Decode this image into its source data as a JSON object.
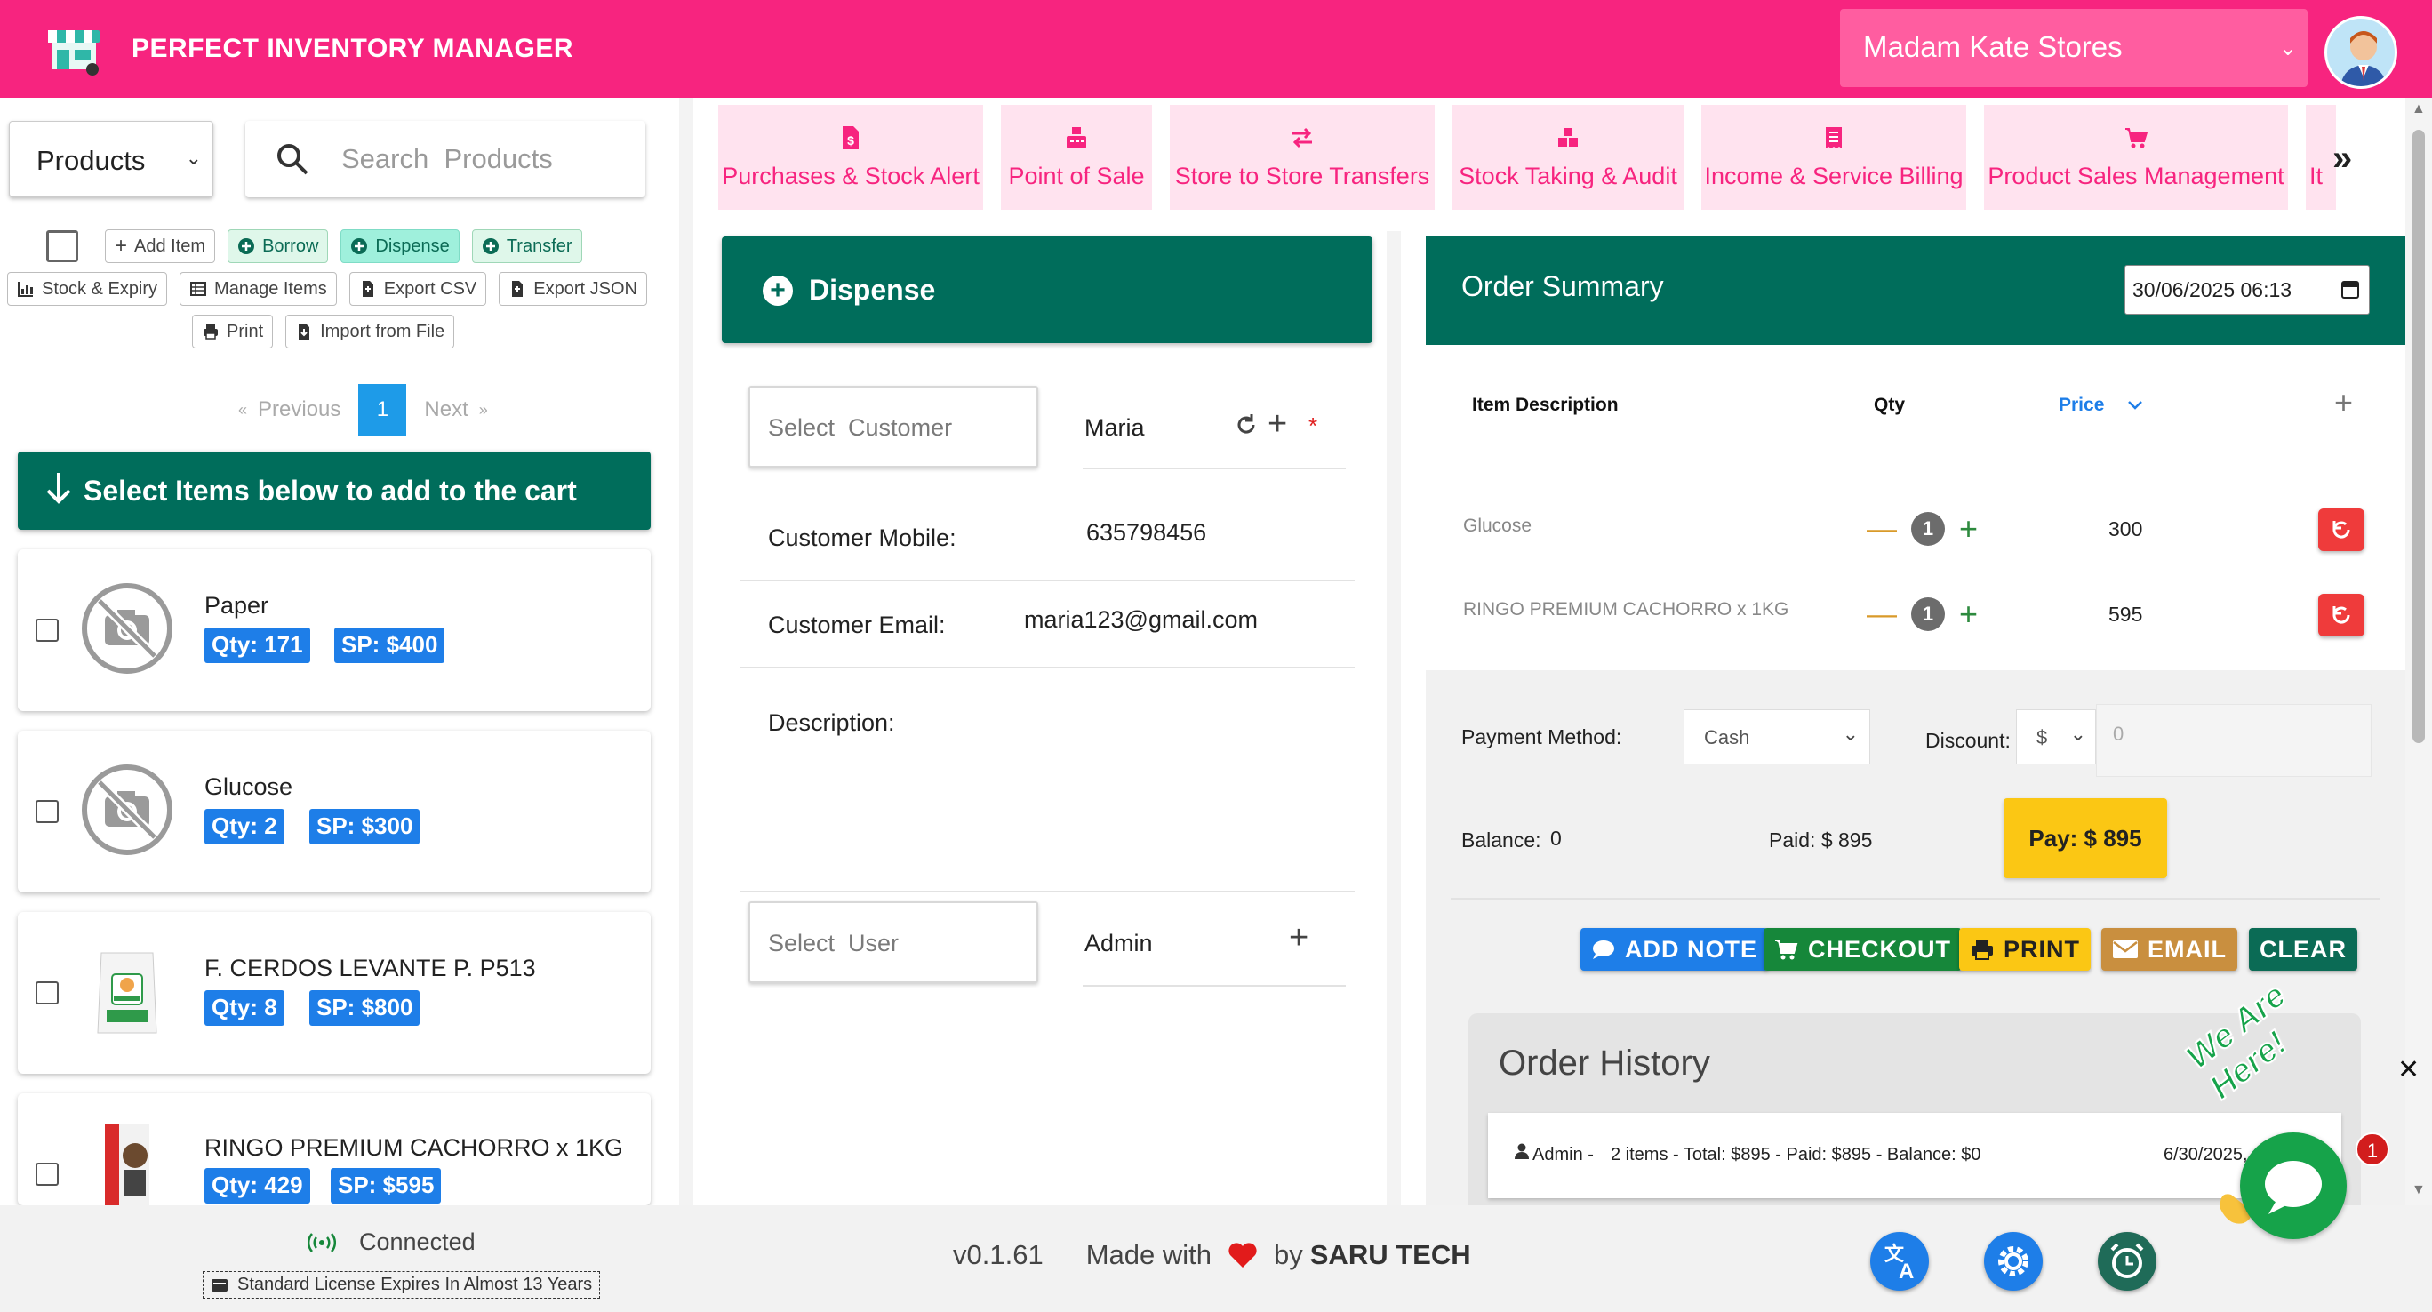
{
  "header": {
    "app_title": "PERFECT INVENTORY MANAGER",
    "store": "Madam Kate Stores",
    "brand_color": "#f7247f"
  },
  "left": {
    "category_select": "Products",
    "search_placeholder": "Search  Products",
    "toolbar_row1": [
      "Add Item",
      "Borrow",
      "Dispense",
      "Transfer"
    ],
    "toolbar_row2": [
      "Stock & Expiry",
      "Manage Items",
      "Export CSV",
      "Export JSON"
    ],
    "toolbar_row3": [
      "Print",
      "Import from File"
    ],
    "pager": {
      "previous": "Previous",
      "current": "1",
      "next": "Next"
    },
    "cart_banner": "Select Items below to add to the cart",
    "products": [
      {
        "name": "Paper",
        "qty": "Qty: 171",
        "sp": "SP: $400"
      },
      {
        "name": "Glucose",
        "qty": "Qty: 2",
        "sp": "SP: $300"
      },
      {
        "name": "F. CERDOS LEVANTE P. P513",
        "qty": "Qty: 8",
        "sp": "SP: $800"
      },
      {
        "name": "RINGO PREMIUM CACHORRO x 1KG",
        "qty": "Qty: 429",
        "sp": "SP: $595"
      }
    ]
  },
  "tabs": [
    {
      "label": "Purchases & Stock Alert",
      "icon": "invoice-dollar-icon"
    },
    {
      "label": "Point of Sale",
      "icon": "cash-register-icon"
    },
    {
      "label": "Store to Store Transfers",
      "icon": "exchange-arrows-icon"
    },
    {
      "label": "Stock Taking & Audit",
      "icon": "boxes-icon"
    },
    {
      "label": "Income & Service Billing",
      "icon": "receipt-icon"
    },
    {
      "label": "Product Sales Management",
      "icon": "cart-icon"
    },
    {
      "label": "It",
      "icon": ""
    }
  ],
  "dispense": {
    "title": "Dispense",
    "customer_placeholder": "Select  Customer",
    "customer_name": "Maria",
    "required_mark": "*",
    "mobile_label": "Customer Mobile:",
    "mobile_value": "635798456",
    "email_label": "Customer Email:",
    "email_value": "maria123@gmail.com",
    "description_label": "Description:",
    "user_placeholder": "Select  User",
    "user_name": "Admin"
  },
  "order_summary": {
    "title": "Order Summary",
    "datetime": "30/06/2025 06:13",
    "col_item": "Item Description",
    "col_qty": "Qty",
    "col_price": "Price",
    "items": [
      {
        "name": "Glucose",
        "qty": "1",
        "price": "300"
      },
      {
        "name": "RINGO PREMIUM CACHORRO x 1KG",
        "qty": "1",
        "price": "595"
      }
    ],
    "payment_method_label": "Payment Method:",
    "payment_method": "Cash",
    "discount_label": "Discount:",
    "discount_unit": "$",
    "discount_placeholder": "0",
    "balance_label": "Balance:",
    "balance_value": "0",
    "paid": "Paid: $ 895",
    "pay_button": "Pay: $ 895",
    "actions": [
      "ADD NOTE",
      "CHECKOUT",
      "PRINT",
      "EMAIL",
      "CLEAR"
    ],
    "action_colors": [
      "#1e7ee8",
      "#16873a",
      "#fbc714",
      "#c98f3f",
      "#0b6b55"
    ]
  },
  "order_history": {
    "title": "Order History",
    "entry_user": "Admin -",
    "entry_summary": "2 items - Total: $895 - Paid: $895 - Balance: $0",
    "entry_date": "6/30/2025, 14:"
  },
  "footer": {
    "status": "Connected",
    "license": "Standard License Expires In Almost 13 Years",
    "version": "v0.1.61",
    "made_with": "Made with",
    "by": "by",
    "company": "SARU TECH"
  },
  "chat": {
    "label": "We Are Here!",
    "badge": "1",
    "close": "✕"
  }
}
